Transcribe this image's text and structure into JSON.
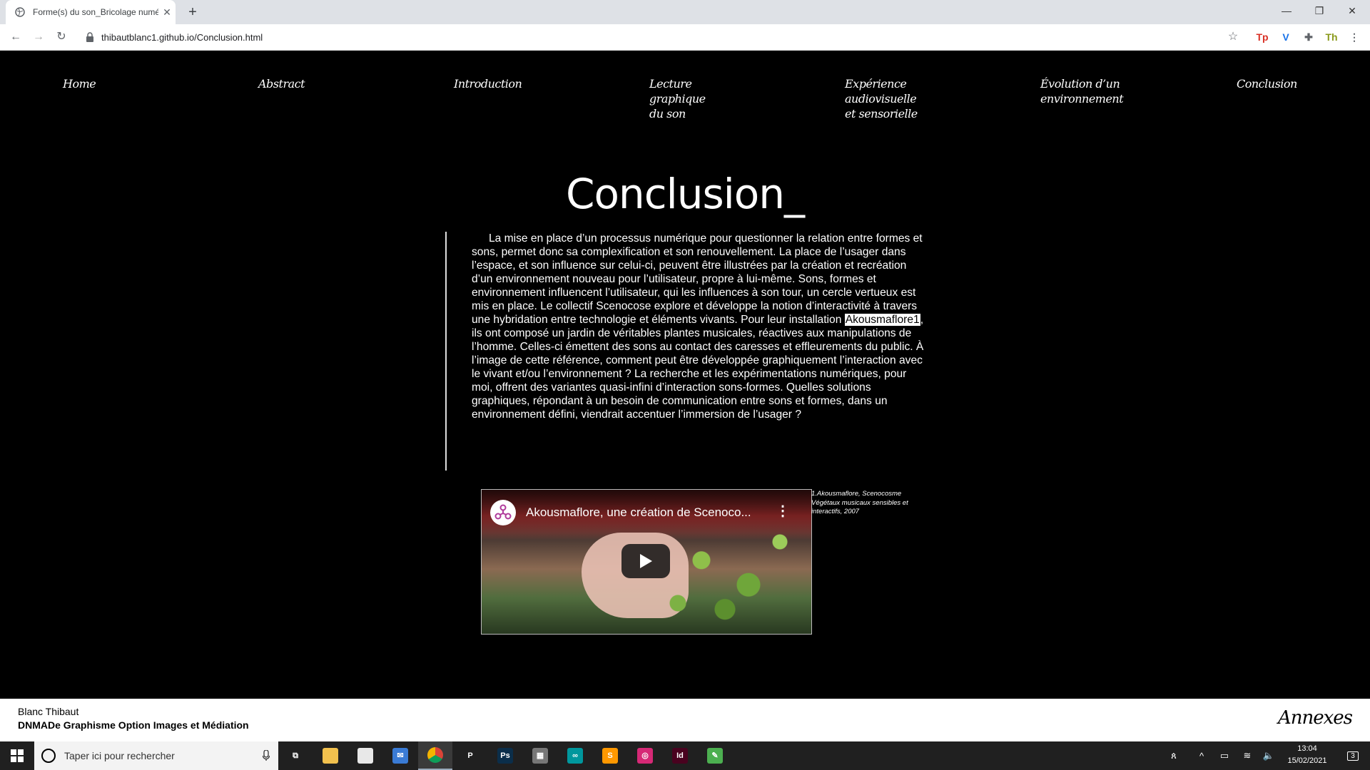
{
  "browser": {
    "tab_title": "Forme(s) du son_Bricolage numé",
    "tab_close": "✕",
    "new_tab": "+",
    "url": "thibautblanc1.github.io/Conclusion.html",
    "window_controls": {
      "minimize": "—",
      "restore": "❐",
      "close": "✕"
    },
    "extensions": [
      {
        "name": "tp-extension-icon",
        "label": "Tp",
        "color": "#d93025"
      },
      {
        "name": "v-extension-icon",
        "label": "V",
        "color": "#1a73e8"
      },
      {
        "name": "puzzle-extension-icon",
        "label": "✚",
        "color": "#5f6368"
      },
      {
        "name": "th-extension-icon",
        "label": "Th",
        "color": "#8a9a1b"
      },
      {
        "name": "menu-kebab-icon",
        "label": "⋮",
        "color": "#5f6368"
      }
    ]
  },
  "site_nav": [
    {
      "label": "Home"
    },
    {
      "label": "Abstract"
    },
    {
      "label": "Introduction"
    },
    {
      "label": "Lecture graphique du son"
    },
    {
      "label": "Expérience audiovisuelle et sensorielle"
    },
    {
      "label": "Évolution d’un environnement"
    },
    {
      "label": "Conclusion"
    }
  ],
  "main": {
    "title": "Conclusion_",
    "paragraph_before": "La mise en place d’un processus numérique pour questionner la relation entre formes et sons, permet donc sa complexification et son renouvellement. La place de l’usager dans l’espace, et son influence sur celui-ci, peuvent être illustrées par la création et recréation d’un environnement nouveau pour l’utilisateur, propre à lui-même. Sons, formes et environnement influencent l’utilisateur, qui les influences à son tour, un cercle vertueux est mis en place. Le collectif Scenocose explore et développe la notion d’interactivité à travers une hybridation entre technologie et éléments vivants. Pour leur installation ",
    "highlight": "Akousmaflore1",
    "paragraph_after": ", ils ont composé un jardin de véritables plantes musicales, réactives aux manipulations de l’homme. Celles-ci émettent des sons au contact des caresses et effleurements du public. À l’image de cette référence, comment peut être développée graphiquement l’interaction avec le vivant et/ou l’environnement ? La recherche et les expérimentations numériques, pour moi, offrent des variantes quasi-infini d’interaction sons-formes. Quelles solutions graphiques, répondant à un besoin de communication entre sons et formes, dans un environnement défini, viendrait accentuer l’immersion de l’usager ?"
  },
  "video": {
    "title": "Akousmaflore, une création de Scenoco...",
    "kebab": "⋮"
  },
  "caption": "1.Akousmaflore, Scenocosme Végétaux musicaux sensibles et interactifs, 2007",
  "footer": {
    "name": "Blanc Thibaut",
    "course": "DNMADe Graphisme Option Images et Médiation",
    "annexes": "Annexes"
  },
  "taskbar": {
    "search_placeholder": "Taper ici pour rechercher",
    "apps": [
      {
        "name": "task-view-icon",
        "label": "⧉",
        "color": "transparent"
      },
      {
        "name": "file-explorer-icon",
        "label": "",
        "color": "#f2c14e"
      },
      {
        "name": "store-icon",
        "label": "",
        "color": "#e8e8e8"
      },
      {
        "name": "mail-icon",
        "label": "✉",
        "color": "#3a7bd5"
      },
      {
        "name": "chrome-icon",
        "label": "",
        "color": "#e0b52c"
      },
      {
        "name": "p-app-icon",
        "label": "P",
        "color": "transparent"
      },
      {
        "name": "photoshop-icon",
        "label": "Ps",
        "color": "#0b2e4a"
      },
      {
        "name": "calculator-icon",
        "label": "▦",
        "color": "#777"
      },
      {
        "name": "arduino-icon",
        "label": "∞",
        "color": "#00979d"
      },
      {
        "name": "sublime-icon",
        "label": "S",
        "color": "#ff9800"
      },
      {
        "name": "instagram-icon",
        "label": "◎",
        "color": "#d62976"
      },
      {
        "name": "indesign-icon",
        "label": "Id",
        "color": "#49021f"
      },
      {
        "name": "paint-icon",
        "label": "✎",
        "color": "#4caf50"
      }
    ],
    "tray": {
      "people": "ጰ",
      "chevron": "^",
      "battery": "▭",
      "wifi": "≋",
      "volume": "🔈",
      "notification_count": "3"
    },
    "time": "13:04",
    "date": "15/02/2021"
  }
}
